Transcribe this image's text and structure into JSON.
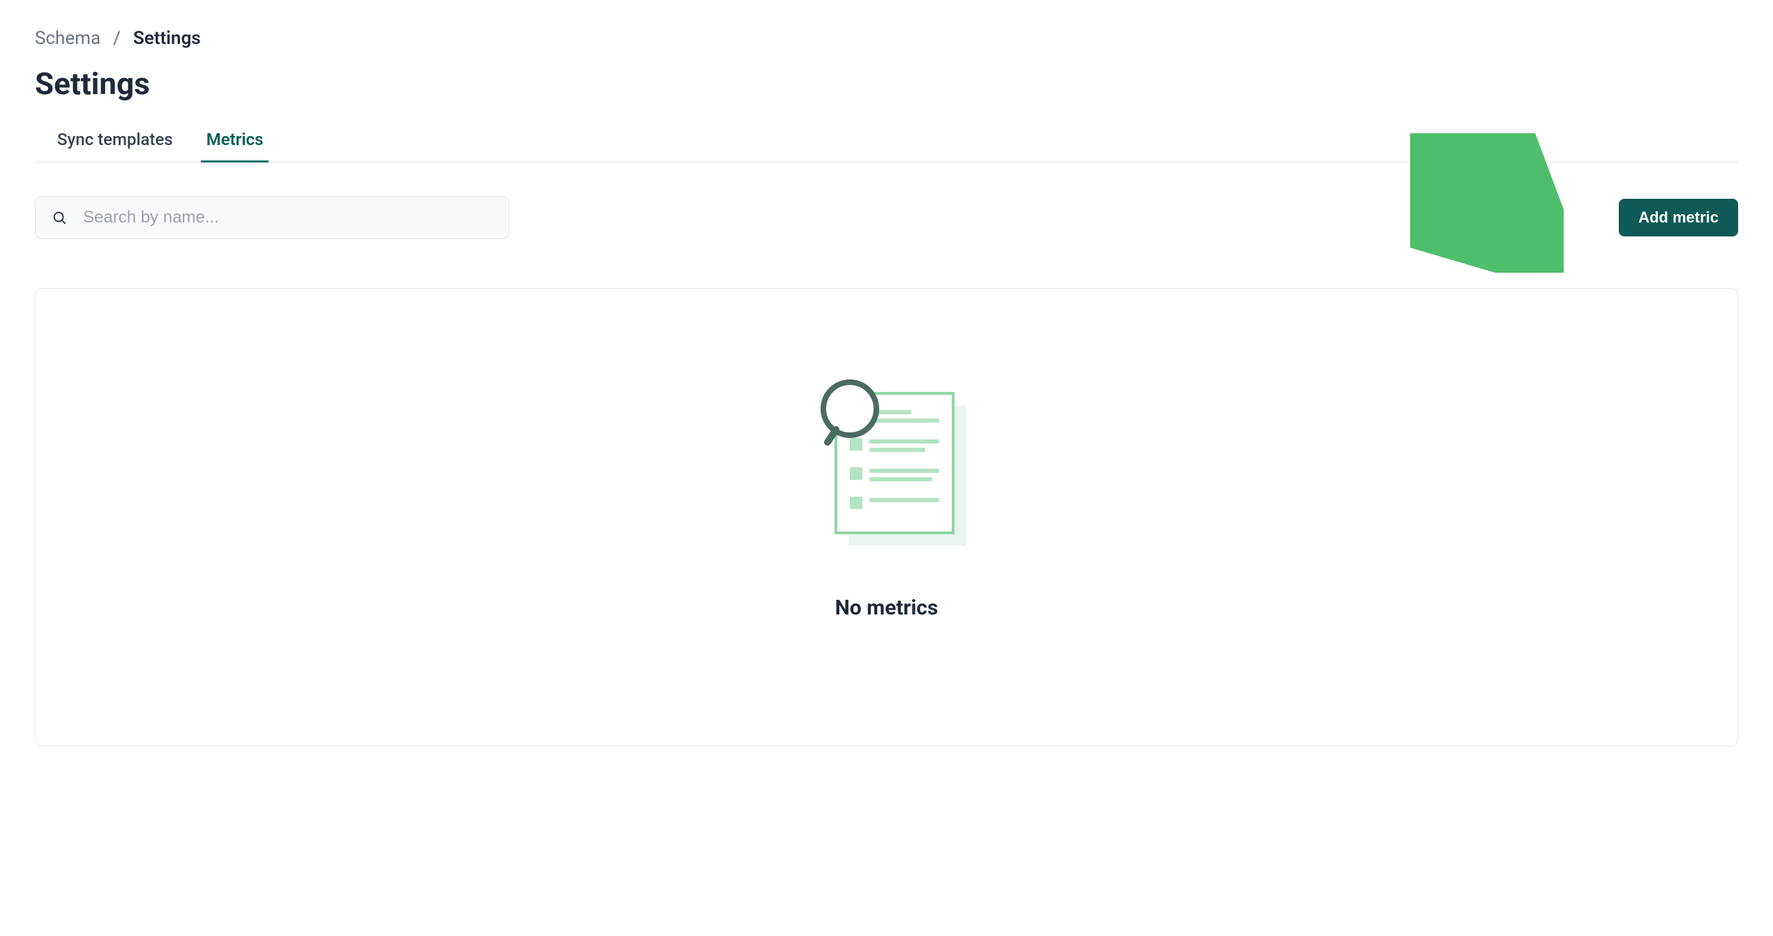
{
  "breadcrumb": {
    "parent": "Schema",
    "separator": "/",
    "current": "Settings"
  },
  "page_title": "Settings",
  "tabs": [
    {
      "label": "Sync templates",
      "active": false
    },
    {
      "label": "Metrics",
      "active": true
    }
  ],
  "search": {
    "placeholder": "Search by name...",
    "value": ""
  },
  "toolbar": {
    "add_metric_label": "Add metric"
  },
  "empty_state": {
    "title": "No metrics"
  },
  "colors": {
    "accent_teal": "#0d5a56",
    "arrow_green": "#4ebe6a",
    "illustration_green_light": "#b4e3c5",
    "illustration_green_dark": "#4b6a62"
  }
}
